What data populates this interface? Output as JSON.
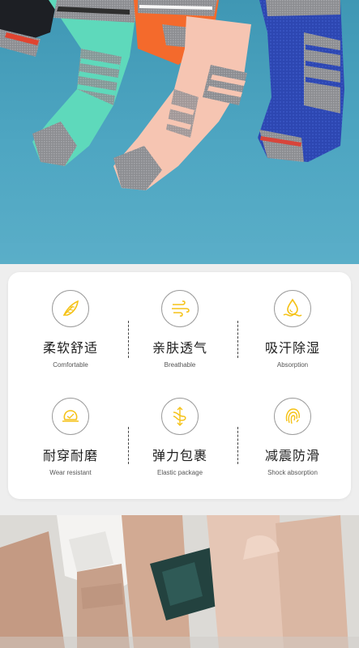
{
  "hero_image": {
    "subject": "sock-product-photo"
  },
  "features": [
    {
      "icon": "feather-icon",
      "title_cn": "柔软舒适",
      "title_en": "Comfortable"
    },
    {
      "icon": "airflow-icon",
      "title_cn": "亲肤透气",
      "title_en": "Breathable"
    },
    {
      "icon": "water-drop-icon",
      "title_cn": "吸汗除湿",
      "title_en": "Absorption"
    },
    {
      "icon": "wear-icon",
      "title_cn": "耐穿耐磨",
      "title_en": "Wear resistant"
    },
    {
      "icon": "elastic-icon",
      "title_cn": "弹力包裹",
      "title_en": "Elastic package"
    },
    {
      "icon": "fingerprint-icon",
      "title_cn": "减震防滑",
      "title_en": "Shock absorption"
    }
  ],
  "colors": {
    "accent_yellow": "#f5c216",
    "hero_blue": "#4ea6c2",
    "sock_mint": "#5ed9bb",
    "sock_peach": "#f6c5b2",
    "sock_blue": "#2f4bb8",
    "sock_grey": "#8d8e92"
  }
}
